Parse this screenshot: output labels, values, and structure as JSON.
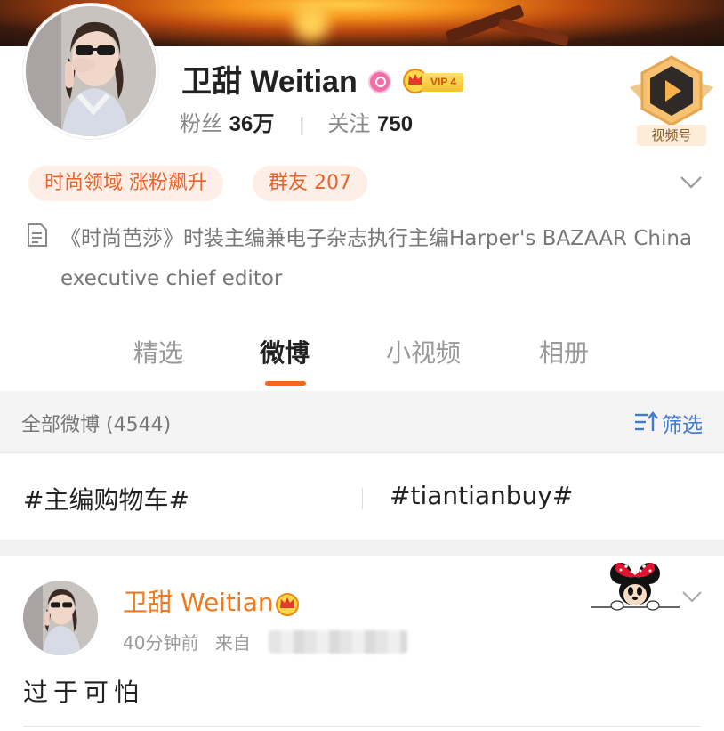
{
  "profile": {
    "name": "卫甜 Weitian",
    "vip_label": "VIP 4",
    "fans_label": "粉丝",
    "fans_count": "36万",
    "following_label": "关注",
    "following_count": "750",
    "video_badge_label": "视频号"
  },
  "chips": {
    "domain": "时尚领域 涨粉飙升",
    "group": "群友 207"
  },
  "bio": "《时尚芭莎》时装主编兼电子杂志执行主编Harper's BAZAAR China executive chief editor",
  "tabs": [
    {
      "label": "精选"
    },
    {
      "label": "微博"
    },
    {
      "label": "小视频"
    },
    {
      "label": "相册"
    }
  ],
  "filter_bar": {
    "all_label": "全部微博 (4544)",
    "filter_label": "筛选"
  },
  "topics": [
    "#主编购物车#",
    "#tiantianbuy#"
  ],
  "post": {
    "author": "卫甜 Weitian",
    "time": "40分钟前",
    "source_prefix": "来自",
    "text": "过于可怕"
  },
  "colors": {
    "accent_orange": "#f26a21",
    "link_blue": "#3f7ad6",
    "chip_bg": "#fdeee8"
  }
}
